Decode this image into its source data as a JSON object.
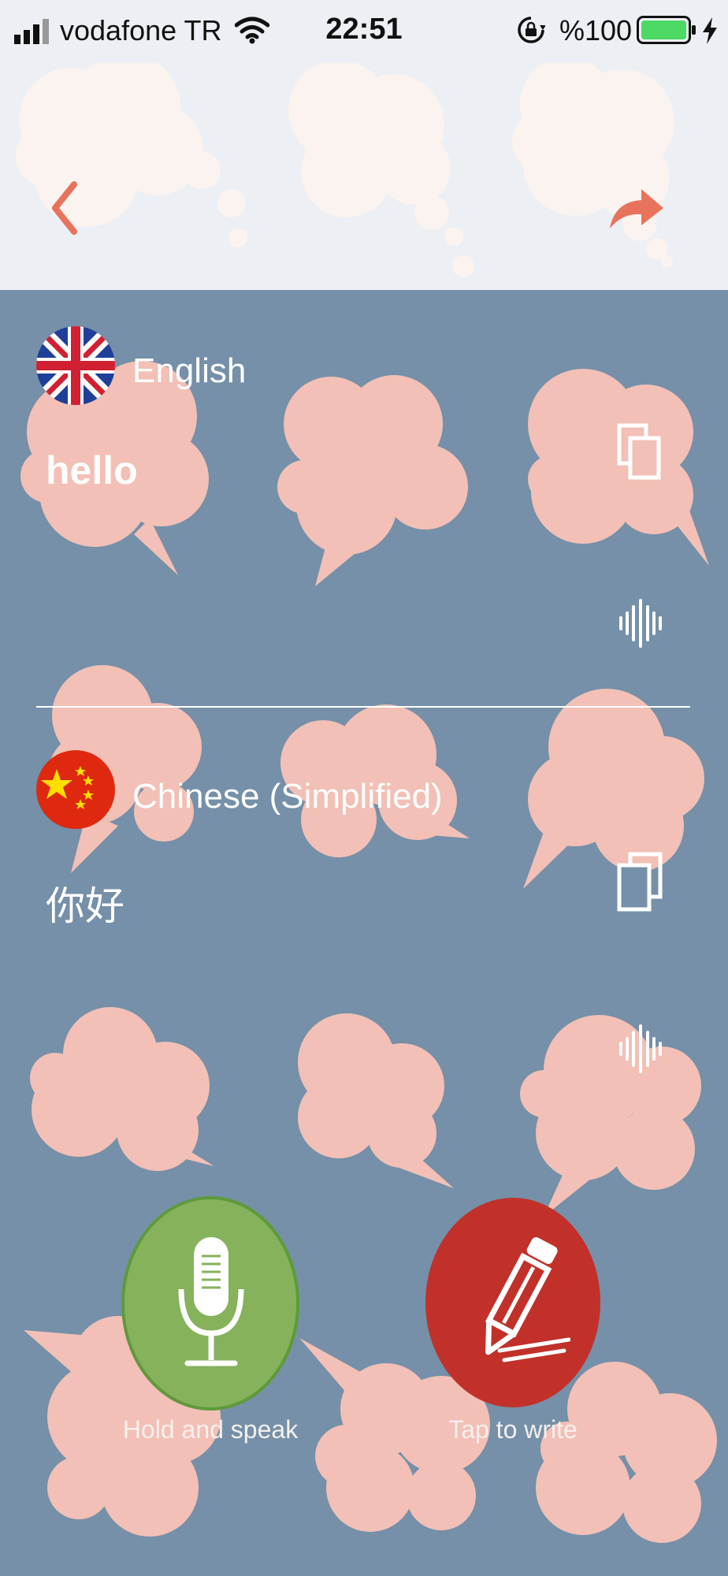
{
  "status_bar": {
    "carrier": "vodafone TR",
    "time": "22:51",
    "battery_percent": "%100",
    "icons": [
      "signal-icon",
      "wifi-icon",
      "orientation-lock-icon",
      "battery-icon",
      "charging-icon"
    ]
  },
  "header": {
    "back_icon": "chevron-left-icon",
    "share_icon": "share-arrow-icon"
  },
  "source": {
    "language": "English",
    "flag": "uk-flag-icon",
    "text": "hello",
    "actions": [
      "copy-icon",
      "audio-wave-icon"
    ]
  },
  "target": {
    "language": "Chinese (Simplified)",
    "flag": "china-flag-icon",
    "text": "你好",
    "actions": [
      "copy-icon",
      "audio-wave-icon"
    ]
  },
  "controls": {
    "speak_label": "Hold and speak",
    "write_label": "Tap to write"
  },
  "colors": {
    "background": "#7590a8",
    "header_bg": "#eceff3",
    "cloud_pink": "#f2c0b6",
    "accent_red": "#c1312a",
    "mic_green": "#86b25c",
    "back_arrow": "#e8735c"
  }
}
